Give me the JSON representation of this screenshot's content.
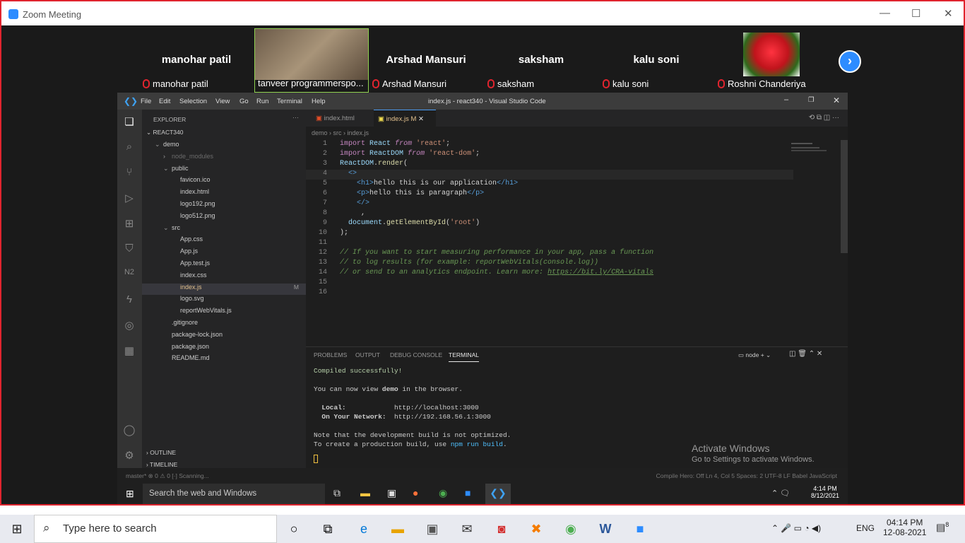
{
  "zoom": {
    "title": "Zoom Meeting",
    "participants": [
      {
        "name": "manohar patil",
        "label": "manohar patil"
      },
      {
        "name": "",
        "label": "tanveer programmerspo..."
      },
      {
        "name": "Arshad Mansuri",
        "label": "Arshad Mansuri"
      },
      {
        "name": "saksham",
        "label": "saksham"
      },
      {
        "name": "kalu soni",
        "label": "kalu soni"
      },
      {
        "name": "",
        "label": "Roshni Chanderiya"
      }
    ]
  },
  "vscode": {
    "menu": [
      "File",
      "Edit",
      "Selection",
      "View",
      "Go",
      "Run",
      "Terminal",
      "Help"
    ],
    "title": "index.js - react340 - Visual Studio Code",
    "explorer_label": "EXPLORER",
    "project": "REACT340",
    "tree": [
      {
        "label": "demo",
        "depth": 1,
        "color": "#ccc",
        "chev": "⌄"
      },
      {
        "label": "node_modules",
        "depth": 2,
        "color": "#6b6b6b",
        "chev": "›"
      },
      {
        "label": "public",
        "depth": 2,
        "color": "#ccc",
        "chev": "⌄"
      },
      {
        "label": "favicon.ico",
        "depth": 3,
        "color": "#ccc",
        "chev": ""
      },
      {
        "label": "index.html",
        "depth": 3,
        "color": "#ccc",
        "chev": ""
      },
      {
        "label": "logo192.png",
        "depth": 3,
        "color": "#ccc",
        "chev": ""
      },
      {
        "label": "logo512.png",
        "depth": 3,
        "color": "#ccc",
        "chev": ""
      },
      {
        "label": "src",
        "depth": 2,
        "color": "#ccc",
        "chev": "⌄"
      },
      {
        "label": "App.css",
        "depth": 3,
        "color": "#ccc",
        "chev": ""
      },
      {
        "label": "App.js",
        "depth": 3,
        "color": "#ccc",
        "chev": ""
      },
      {
        "label": "App.test.js",
        "depth": 3,
        "color": "#ccc",
        "chev": ""
      },
      {
        "label": "index.css",
        "depth": 3,
        "color": "#ccc",
        "chev": ""
      },
      {
        "label": "index.js",
        "depth": 3,
        "color": "#e2c08d",
        "chev": "",
        "badge": "M",
        "selected": true
      },
      {
        "label": "logo.svg",
        "depth": 3,
        "color": "#ccc",
        "chev": ""
      },
      {
        "label": "reportWebVitals.js",
        "depth": 3,
        "color": "#ccc",
        "chev": ""
      },
      {
        "label": ".gitignore",
        "depth": 2,
        "color": "#ccc",
        "chev": ""
      },
      {
        "label": "package-lock.json",
        "depth": 2,
        "color": "#ccc",
        "chev": ""
      },
      {
        "label": "package.json",
        "depth": 2,
        "color": "#ccc",
        "chev": ""
      },
      {
        "label": "README.md",
        "depth": 2,
        "color": "#ccc",
        "chev": ""
      }
    ],
    "outline": "OUTLINE",
    "timeline": "TIMELINE",
    "tabs": {
      "t1": "index.html",
      "t2": "index.js",
      "t2_badge": "M"
    },
    "breadcrumb": "demo › src › index.js",
    "panel_tabs": [
      "PROBLEMS",
      "OUTPUT",
      "DEBUG CONSOLE",
      "TERMINAL"
    ],
    "terminal_shell": "node",
    "terminal": {
      "l1": "Compiled successfully!",
      "l2a": "You can now view ",
      "l2b": "demo",
      "l2c": " in the browser.",
      "l3a": "  Local:            ",
      "l3b": "http://localhost:3000",
      "l4a": "  On Your Network:  ",
      "l4b": "http://192.168.56.1:3000",
      "l5": "Note that the development build is not optimized.",
      "l6a": "To create a production build, use ",
      "l6b": "npm run build",
      "l6c": "."
    },
    "status_left": "master*   ⊗ 0 ⚠ 0   [·] Scanning...",
    "status_right": "Compile Hero: Off    Ln 4, Col 5    Spaces: 2    UTF-8    LF    Babel JavaScript"
  },
  "activate": {
    "title": "Activate Windows",
    "sub": "Go to Settings to activate Windows."
  },
  "inner_taskbar": {
    "search": "Search the web and Windows",
    "time": "4:14 PM",
    "date": "8/12/2021"
  },
  "taskbar": {
    "search": "Type here to search",
    "lang": "ENG",
    "time": "04:14 PM",
    "date": "12-08-2021",
    "notif": "8"
  }
}
